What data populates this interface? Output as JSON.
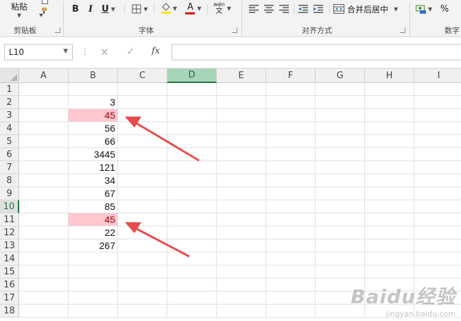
{
  "ribbon": {
    "paste_label": "粘贴",
    "clipboard_group": "剪贴板",
    "bold": "B",
    "italic": "I",
    "underline": "U",
    "font_color_letter": "A",
    "phonetic_top": "wén",
    "phonetic_bottom": "文",
    "font_group": "字体",
    "merge_center": "合并后居中",
    "align_group": "对齐方式",
    "percent": "%",
    "number_group": "数字"
  },
  "formula_bar": {
    "name_box": "L10",
    "fx": "fx",
    "formula": ""
  },
  "sheet": {
    "columns": [
      "A",
      "B",
      "C",
      "D",
      "E",
      "F",
      "G",
      "H",
      "I"
    ],
    "selected_column": "D",
    "rows": [
      "1",
      "2",
      "3",
      "4",
      "5",
      "6",
      "7",
      "8",
      "9",
      "10",
      "11",
      "12",
      "13",
      "14",
      "15",
      "16",
      "17",
      "18"
    ],
    "selected_row": "10",
    "column_b_values": [
      "",
      "3",
      "45",
      "56",
      "66",
      "3445",
      "121",
      "34",
      "67",
      "85",
      "45",
      "22",
      "267",
      "",
      "",
      "",
      "",
      ""
    ],
    "highlighted_rows": [
      "3",
      "11"
    ],
    "highlight_fill": "#ffc7ce",
    "highlight_text": "#9c0006",
    "accent": "#217346",
    "arrow_color": "#e84c4c"
  },
  "watermark": {
    "brand": "Baidu经验",
    "url": "jingyan.baidu.com"
  }
}
